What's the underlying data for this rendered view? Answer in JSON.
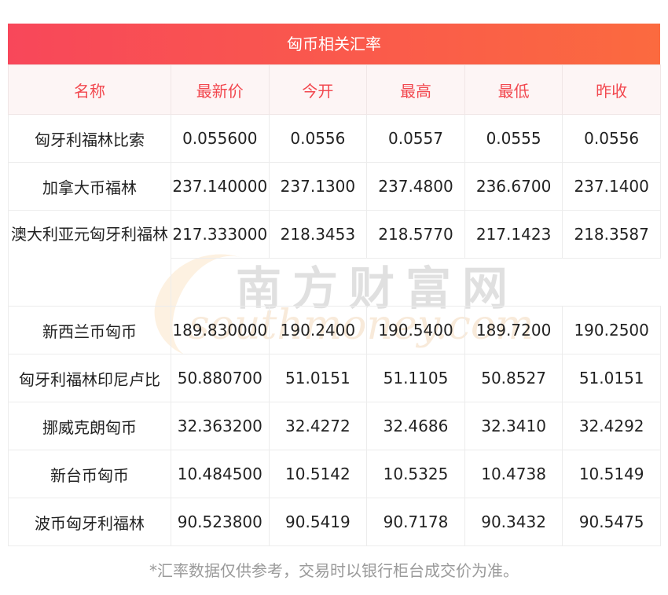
{
  "title": "匈币相关汇率",
  "columns": [
    "名称",
    "最新价",
    "今开",
    "最高",
    "最低",
    "昨收"
  ],
  "rows": [
    {
      "name": "匈牙利福林比索",
      "latest": "0.055600",
      "open": "0.0556",
      "high": "0.0557",
      "low": "0.0555",
      "prev": "0.0556"
    },
    {
      "name": "加拿大币福林",
      "latest": "237.140000",
      "open": "237.1300",
      "high": "237.4800",
      "low": "236.6700",
      "prev": "237.1400"
    },
    {
      "name": "澳大利亚元匈牙利福林",
      "latest": "217.333000",
      "open": "218.3453",
      "high": "218.5770",
      "low": "217.1423",
      "prev": "218.3587"
    },
    {
      "name": "新西兰币匈币",
      "latest": "189.830000",
      "open": "190.2400",
      "high": "190.5400",
      "low": "189.7200",
      "prev": "190.2500"
    },
    {
      "name": "匈牙利福林印尼卢比",
      "latest": "50.880700",
      "open": "51.0151",
      "high": "51.1105",
      "low": "50.8527",
      "prev": "51.0151"
    },
    {
      "name": "挪威克朗匈币",
      "latest": "32.363200",
      "open": "32.4272",
      "high": "32.4686",
      "low": "32.3410",
      "prev": "32.4292"
    },
    {
      "name": "新台币匈币",
      "latest": "10.484500",
      "open": "10.5142",
      "high": "10.5325",
      "low": "10.4738",
      "prev": "10.5149"
    },
    {
      "name": "波币匈牙利福林",
      "latest": "90.523800",
      "open": "90.5419",
      "high": "90.7178",
      "low": "90.3432",
      "prev": "90.5475"
    }
  ],
  "watermark": {
    "cn": "南方财富网",
    "en": "southmoney.com"
  },
  "note": "*汇率数据仅供参考，交易时以银行柜台成交价为准。",
  "colors": {
    "accent_start": "#f8475a",
    "accent_end": "#fb6a3f",
    "header_text": "#f2484f"
  }
}
